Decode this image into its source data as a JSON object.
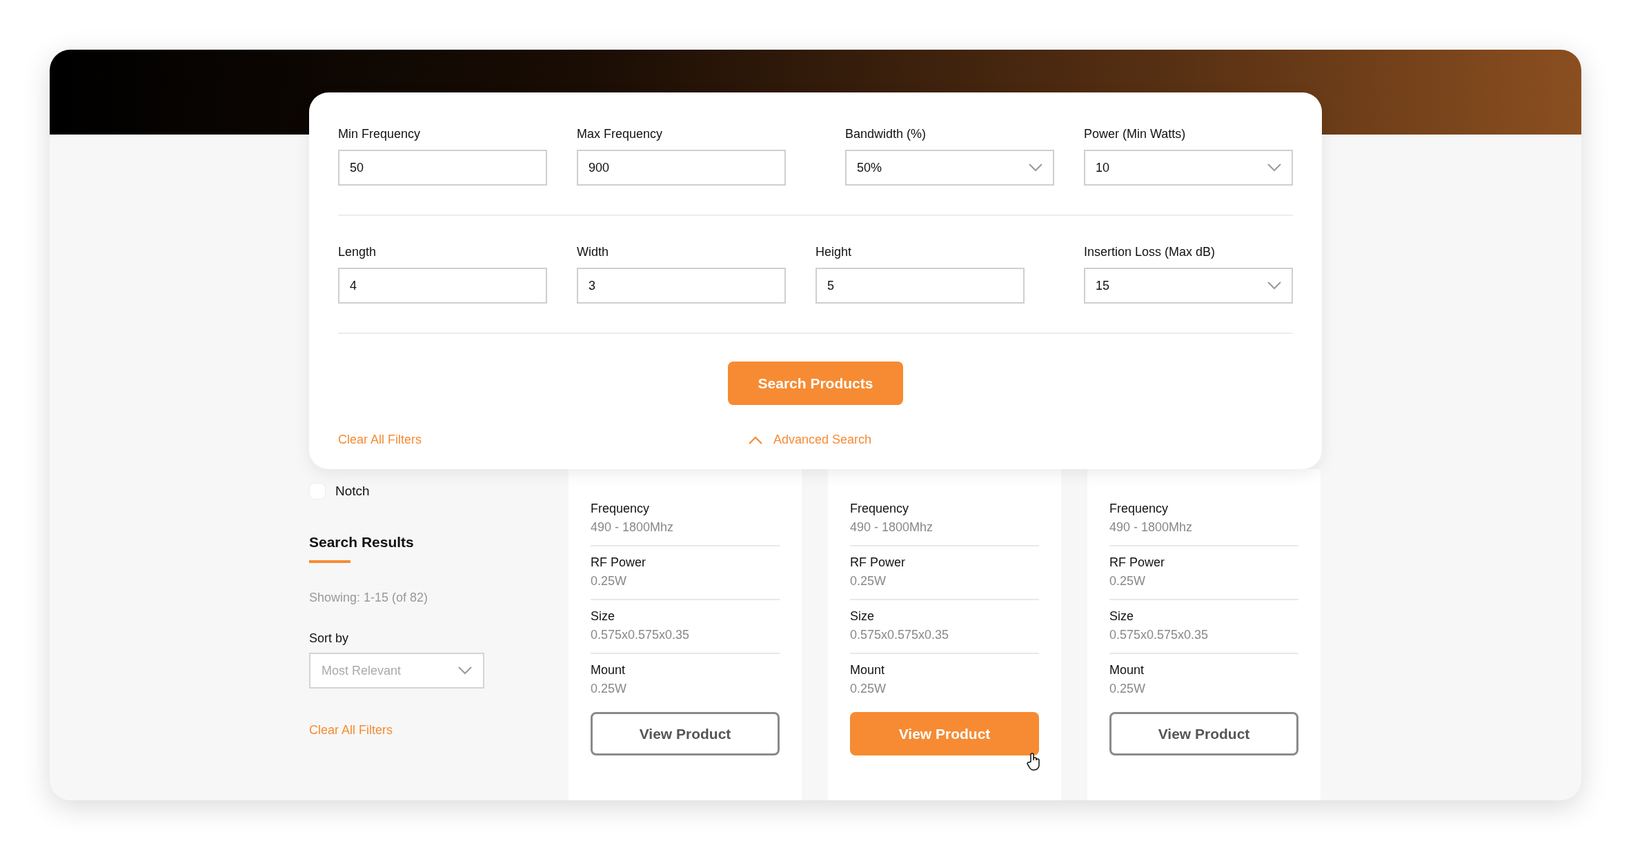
{
  "search_panel": {
    "rows": [
      {
        "groups": [
          [
            {
              "label": "Min Frequency",
              "kind": "text",
              "value": "50"
            },
            {
              "label": "Max Frequency",
              "kind": "text",
              "value": "900"
            }
          ],
          [
            {
              "label": "Bandwidth (%)",
              "kind": "select",
              "value": "50%"
            },
            {
              "label": "Power (Min Watts)",
              "kind": "select",
              "value": "10"
            }
          ]
        ]
      },
      {
        "groups": [
          [
            {
              "label": "Length",
              "kind": "text",
              "value": "4"
            },
            {
              "label": "Width",
              "kind": "text",
              "value": "3"
            },
            {
              "label": "Height",
              "kind": "text",
              "value": "5"
            }
          ],
          [
            {
              "label": "Insertion Loss (Max dB)",
              "kind": "select",
              "value": "15"
            }
          ]
        ]
      }
    ],
    "search_button": "Search Products",
    "clear_link": "Clear All Filters",
    "advanced_link": "Advanced Search"
  },
  "sidebar": {
    "filter": {
      "label": "Notch",
      "checked": false
    },
    "heading": "Search Results",
    "showing": "Showing: 1-15 (of 82)",
    "sort_label": "Sort by",
    "sort_value": "Most Relevant",
    "clear_link": "Clear All Filters"
  },
  "products": [
    {
      "specs": [
        {
          "label": "Frequency",
          "value": "490 - 1800Mhz"
        },
        {
          "label": "RF Power",
          "value": "0.25W"
        },
        {
          "label": "Size",
          "value": "0.575x0.575x0.35"
        },
        {
          "label": "Mount",
          "value": "0.25W"
        }
      ],
      "button": "View Product",
      "highlighted": false
    },
    {
      "specs": [
        {
          "label": "Frequency",
          "value": "490 - 1800Mhz"
        },
        {
          "label": "RF Power",
          "value": "0.25W"
        },
        {
          "label": "Size",
          "value": "0.575x0.575x0.35"
        },
        {
          "label": "Mount",
          "value": "0.25W"
        }
      ],
      "button": "View Product",
      "highlighted": true
    },
    {
      "specs": [
        {
          "label": "Frequency",
          "value": "490 - 1800Mhz"
        },
        {
          "label": "RF Power",
          "value": "0.25W"
        },
        {
          "label": "Size",
          "value": "0.575x0.575x0.35"
        },
        {
          "label": "Mount",
          "value": "0.25W"
        }
      ],
      "button": "View Product",
      "highlighted": false
    }
  ]
}
